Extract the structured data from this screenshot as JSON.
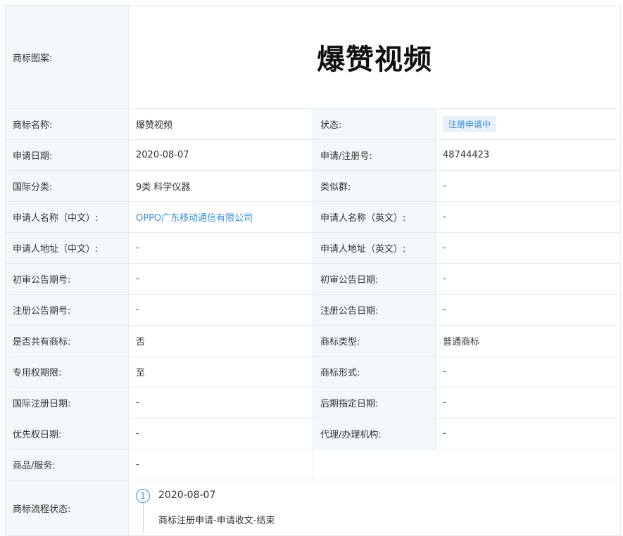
{
  "logo": {
    "label": "商标图案:",
    "text": "爆赞视频"
  },
  "rows": [
    {
      "l1": "商标名称:",
      "v1": "爆赞视频",
      "l2": "状态:",
      "v2": "注册申请中"
    },
    {
      "l1": "申请日期:",
      "v1": "2020-08-07",
      "l2": "申请/注册号:",
      "v2": "48744423"
    },
    {
      "l1": "国际分类:",
      "v1": "9类 科学仪器",
      "l2": "类似群:",
      "v2": "-"
    },
    {
      "l1": "申请人名称（中文）:",
      "v1": "OPPO广东移动通信有限公司",
      "l2": "申请人名称（英文）:",
      "v2": "-"
    },
    {
      "l1": "申请人地址（中文）:",
      "v1": "-",
      "l2": "申请人地址（英文）:",
      "v2": "-"
    },
    {
      "l1": "初审公告期号:",
      "v1": "-",
      "l2": "初审公告日期:",
      "v2": "-"
    },
    {
      "l1": "注册公告期号:",
      "v1": "-",
      "l2": "注册公告日期:",
      "v2": "-"
    },
    {
      "l1": "是否共有商标:",
      "v1": "否",
      "l2": "商标类型:",
      "v2": "普通商标"
    },
    {
      "l1": "专用权期限:",
      "v1": "至",
      "l2": "商标形式:",
      "v2": "-"
    },
    {
      "l1": "国际注册日期:",
      "v1": "-",
      "l2": "后期指定日期:",
      "v2": "-"
    },
    {
      "l1": "优先权日期:",
      "v1": "-",
      "l2": "代理/办理机构:",
      "v2": "-"
    }
  ],
  "goods": {
    "label": "商品/服务:",
    "value": "-"
  },
  "flow": {
    "label": "商标流程状态:",
    "steps": [
      {
        "num": "1",
        "date": "2020-08-07",
        "desc": "商标注册申请-申请收文-结束"
      }
    ]
  },
  "colors": {
    "label_bg": "#f2f8fc",
    "border": "#e6ebf0",
    "accent": "#3a8fd6",
    "badge_bg": "#e6f1fb"
  }
}
